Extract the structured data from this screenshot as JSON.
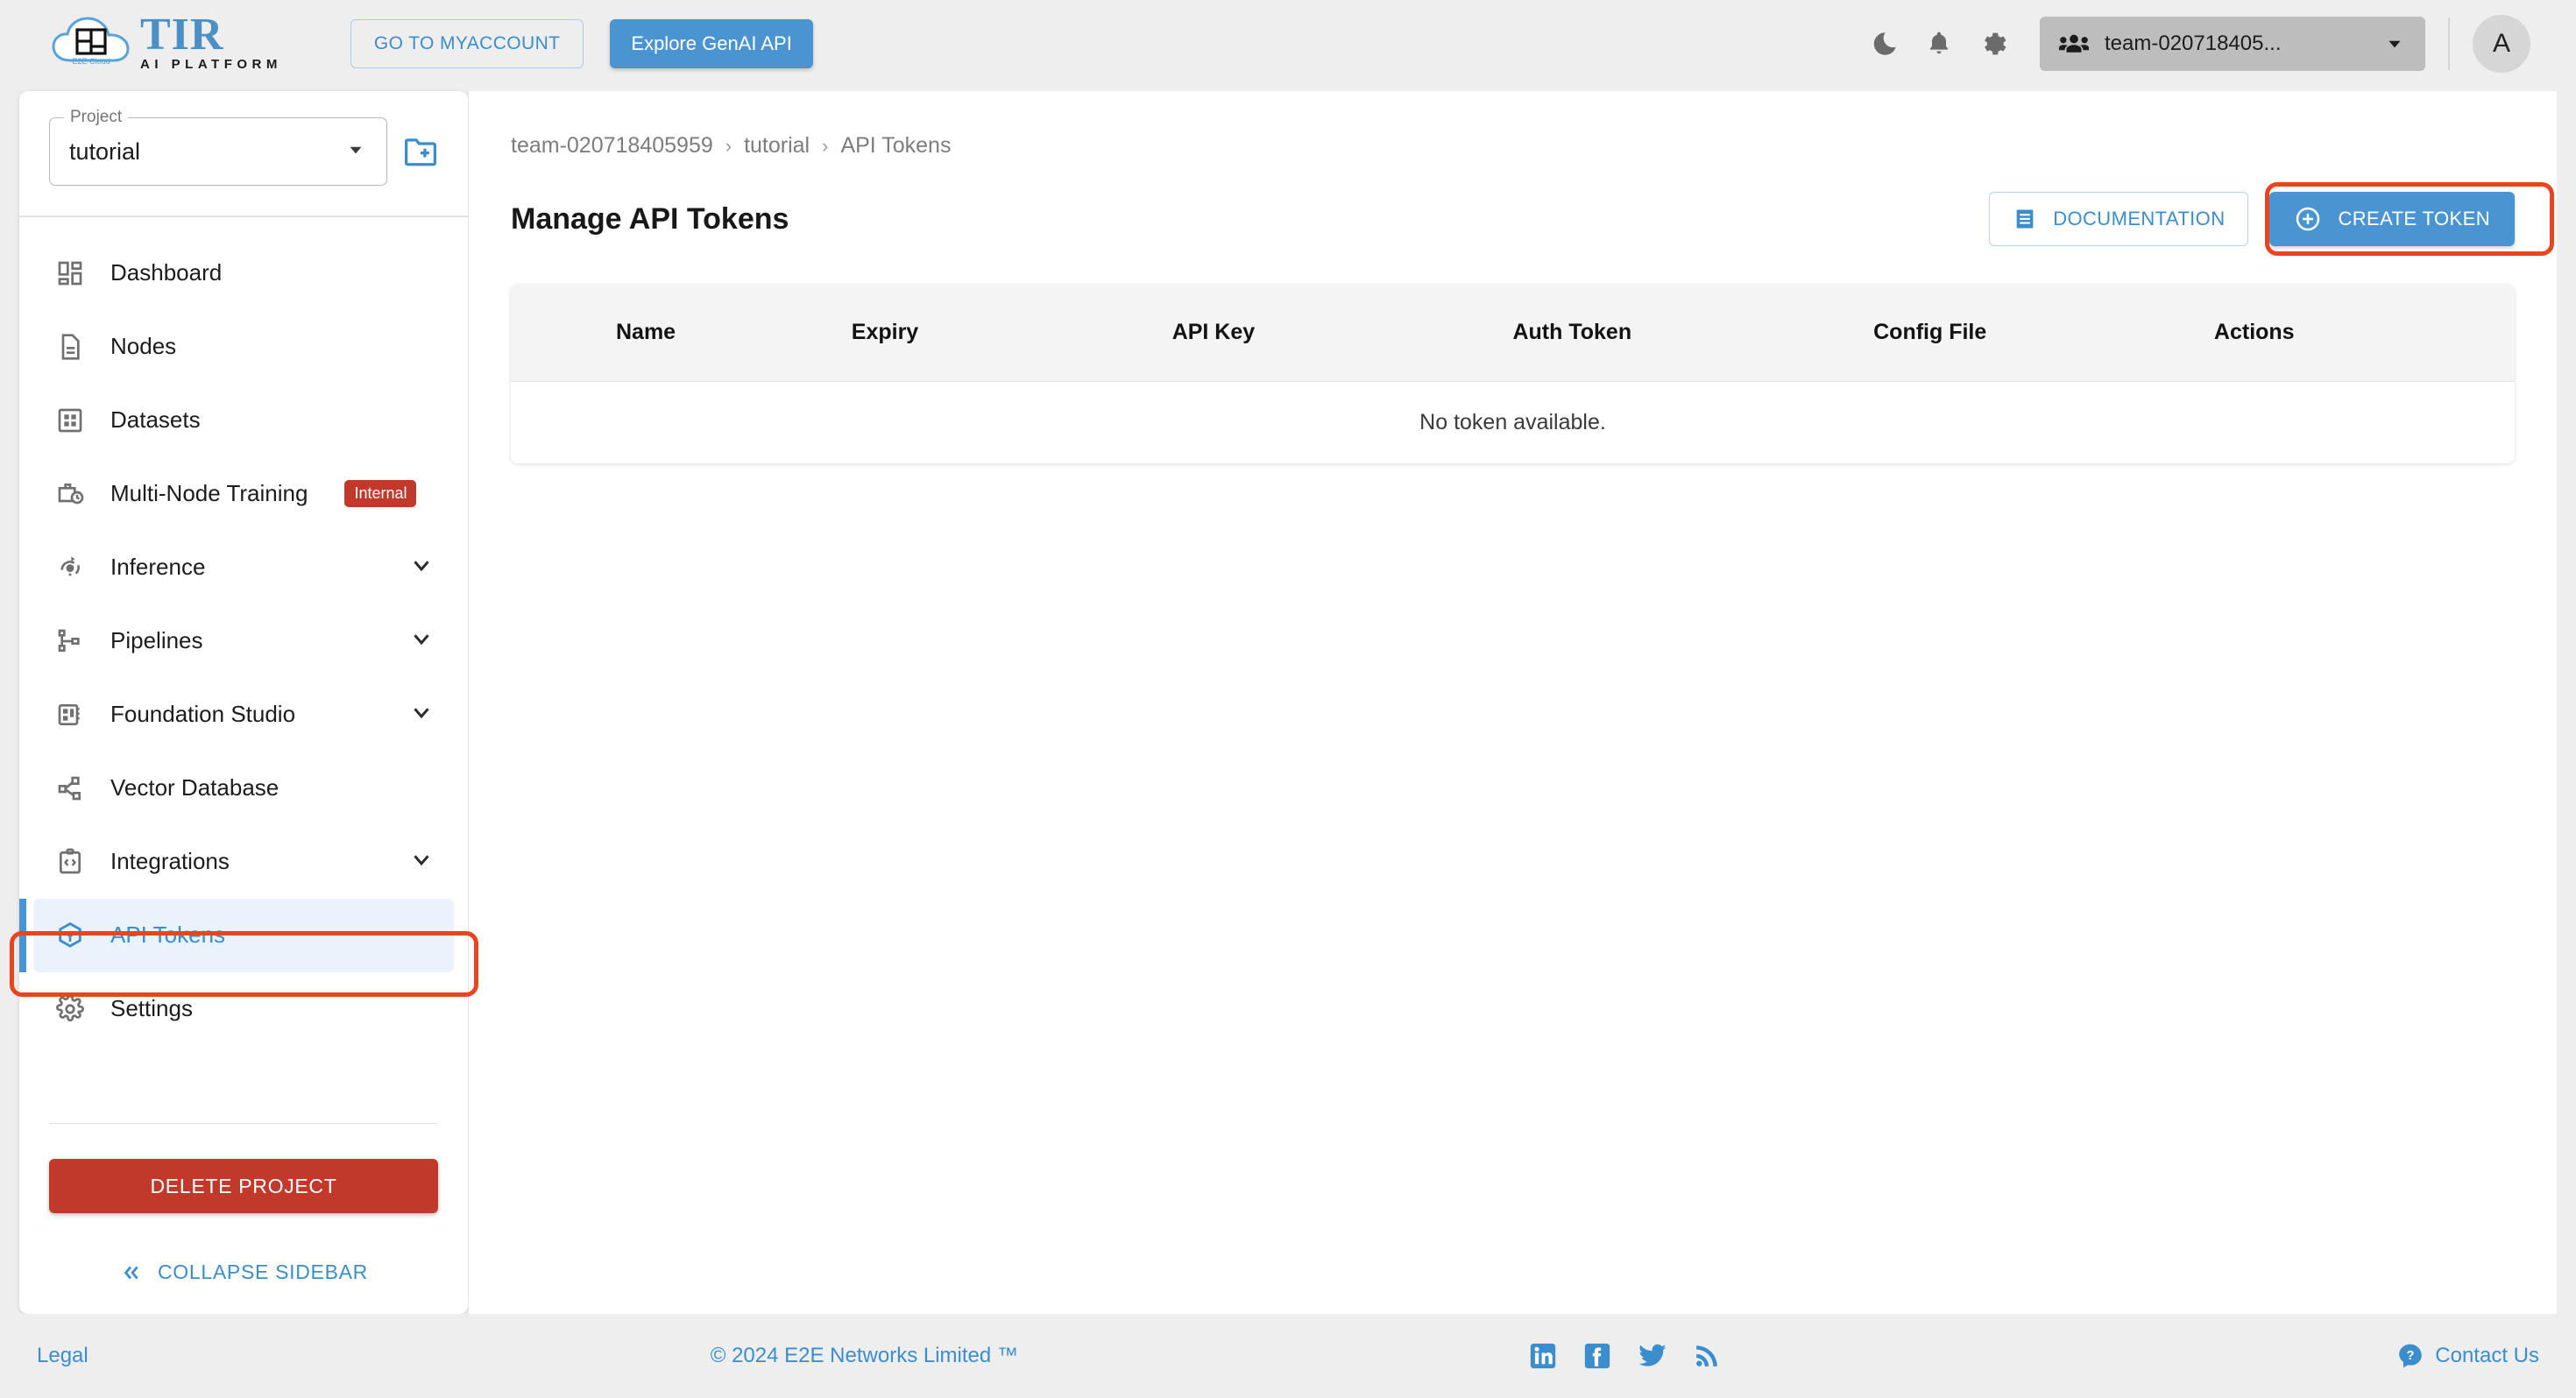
{
  "brand": {
    "logo_title": "TIR",
    "logo_subtitle": "AI PLATFORM",
    "logo_cloud_text": "E2E Cloud",
    "accent_blue": "#4a95d1",
    "link_blue": "#3c8dcc",
    "danger_red": "#c0392b",
    "highlight_orange": "#e8441d"
  },
  "topbar": {
    "myaccount_label": "GO TO MYACCOUNT",
    "genai_label": "Explore GenAI API",
    "icons": [
      {
        "name": "dark-mode-icon",
        "label": "Dark mode"
      },
      {
        "name": "notifications-bell-icon",
        "label": "Notifications"
      },
      {
        "name": "settings-gear-icon",
        "label": "Settings"
      }
    ],
    "team_selector": {
      "icon": "people-group-icon",
      "value": "team-020718405...",
      "caret": "chevron-down-icon"
    },
    "avatar_initial": "A"
  },
  "sidebar": {
    "project": {
      "legend": "Project",
      "value": "tutorial",
      "new_project_icon": "new-folder-icon"
    },
    "items": [
      {
        "label": "Dashboard",
        "icon": "dashboard-grid-icon",
        "badge": null,
        "chevron": false,
        "active": false
      },
      {
        "label": "Nodes",
        "icon": "document-node-icon",
        "badge": null,
        "chevron": false,
        "active": false
      },
      {
        "label": "Datasets",
        "icon": "datasets-grid-icon",
        "badge": null,
        "chevron": false,
        "active": false
      },
      {
        "label": "Multi-Node Training",
        "icon": "briefcase-clock-icon",
        "badge": "Internal",
        "chevron": false,
        "active": false
      },
      {
        "label": "Inference",
        "icon": "lightbulb-refresh-icon",
        "badge": null,
        "chevron": true,
        "active": false
      },
      {
        "label": "Pipelines",
        "icon": "pipeline-nodes-icon",
        "badge": null,
        "chevron": true,
        "active": false
      },
      {
        "label": "Foundation Studio",
        "icon": "studio-chip-icon",
        "badge": null,
        "chevron": true,
        "active": false
      },
      {
        "label": "Vector Database",
        "icon": "vector-graph-icon",
        "badge": null,
        "chevron": false,
        "active": false
      },
      {
        "label": "Integrations",
        "icon": "code-clipboard-icon",
        "badge": null,
        "chevron": true,
        "active": false
      },
      {
        "label": "API Tokens",
        "icon": "cube-token-icon",
        "badge": null,
        "chevron": false,
        "active": true
      },
      {
        "label": "Settings",
        "icon": "settings-gear-icon",
        "badge": null,
        "chevron": false,
        "active": false
      }
    ],
    "delete_project_label": "DELETE PROJECT",
    "collapse_label": "COLLAPSE SIDEBAR",
    "collapse_icon": "double-chevron-left-icon"
  },
  "main": {
    "breadcrumb": [
      "team-020718405959",
      "tutorial",
      "API Tokens"
    ],
    "breadcrumb_separator": "›",
    "page_title": "Manage API Tokens",
    "documentation_label": "DOCUMENTATION",
    "documentation_icon": "document-list-icon",
    "create_token_label": "CREATE TOKEN",
    "create_token_icon": "plus-circle-icon",
    "table": {
      "columns": [
        "Name",
        "Expiry",
        "API Key",
        "Auth Token",
        "Config File",
        "Actions"
      ],
      "rows": [],
      "empty_message": "No token available."
    }
  },
  "footer": {
    "legal_label": "Legal",
    "copyright": "© 2024 E2E Networks Limited ™",
    "social": [
      {
        "name": "linkedin-icon"
      },
      {
        "name": "facebook-icon"
      },
      {
        "name": "twitter-icon"
      },
      {
        "name": "rss-icon"
      }
    ],
    "contact_label": "Contact Us",
    "contact_icon": "help-bubble-icon"
  }
}
